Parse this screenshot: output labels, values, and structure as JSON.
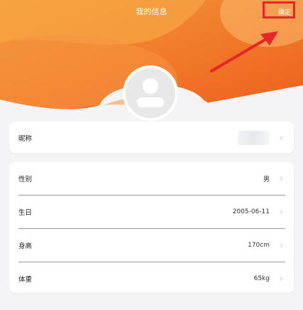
{
  "header": {
    "title": "我的信息",
    "confirm_label": "确定",
    "colors": {
      "orange_top": "#f7b553",
      "orange_bottom": "#f06a20",
      "highlight": "#e8262a"
    }
  },
  "avatar": {
    "icon": "user-placeholder-icon"
  },
  "nickname_row": {
    "label": "昵称",
    "value": ""
  },
  "profile_rows": [
    {
      "label": "性别",
      "value": "男"
    },
    {
      "label": "生日",
      "value": "2005-06-11"
    },
    {
      "label": "身高",
      "value": "170cm"
    },
    {
      "label": "体重",
      "value": "65kg"
    }
  ],
  "chevron": "›"
}
